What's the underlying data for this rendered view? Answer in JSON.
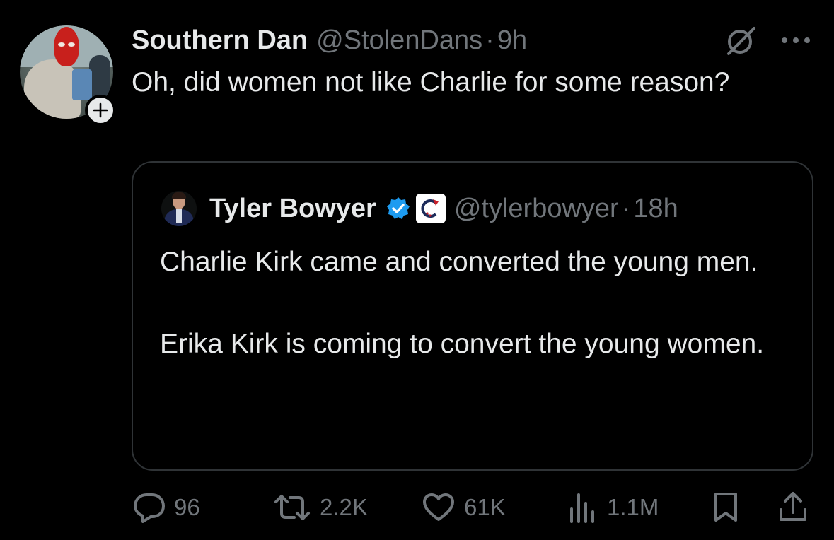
{
  "tweet": {
    "author_name": "Southern Dan",
    "author_handle": "@StolenDans",
    "separator": "·",
    "time": "9h",
    "text": "Oh, did women not like Charlie for some reason?"
  },
  "quoted_tweet": {
    "author_name": "Tyler Bowyer",
    "author_handle": "@tylerbowyer",
    "separator": "·",
    "time": "18h",
    "paragraphs": [
      "Charlie Kirk came and converted the young men.",
      "Erika Kirk is coming to convert the young women."
    ],
    "verified_color": "#1d9bf0"
  },
  "actions": {
    "replies": "96",
    "reposts": "2.2K",
    "likes": "61K",
    "views": "1.1M"
  },
  "icons": {
    "follow": "plus-icon",
    "grok": "grok-icon",
    "more": "more-icon",
    "reply": "reply-icon",
    "repost": "repost-icon",
    "like": "heart-icon",
    "views": "views-icon",
    "bookmark": "bookmark-icon",
    "share": "share-icon"
  },
  "colors": {
    "background": "#000000",
    "text_primary": "#e7e9ea",
    "text_secondary": "#71767b",
    "border": "#2f3336"
  }
}
